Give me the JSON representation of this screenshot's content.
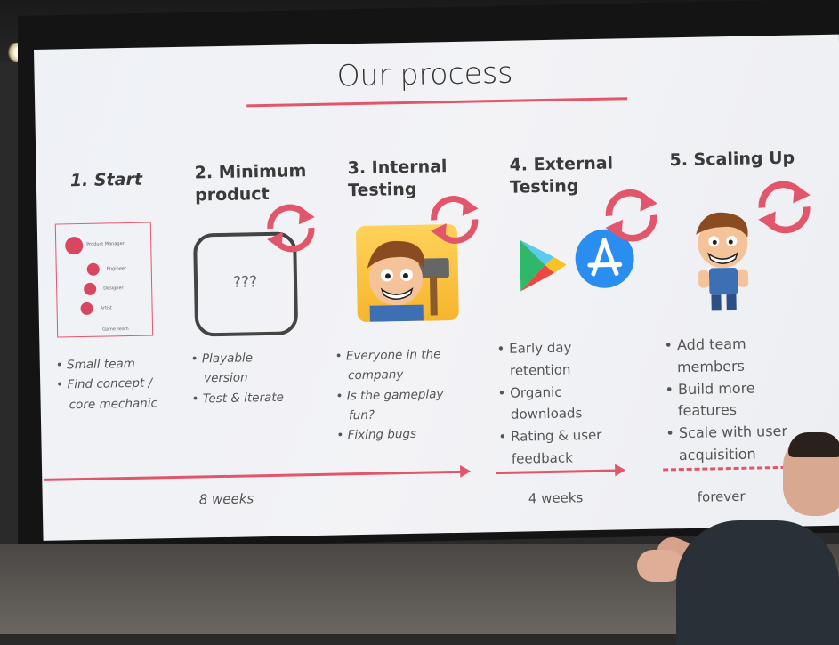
{
  "slide": {
    "title": "Our process",
    "stages": [
      {
        "heading": "1. Start",
        "bullets": [
          "Small team",
          "Find concept / core mechanic"
        ]
      },
      {
        "heading": "2. Minimum product",
        "bullets": [
          "Playable version",
          "Test & iterate"
        ]
      },
      {
        "heading": "3. Internal Testing",
        "bullets": [
          "Everyone in the company",
          "Is the gameplay fun?",
          "Fixing bugs"
        ]
      },
      {
        "heading": "4. External Testing",
        "bullets": [
          "Early day retention",
          "Organic downloads",
          "Rating & user feedback"
        ]
      },
      {
        "heading": "5. Scaling Up",
        "bullets": [
          "Add team members",
          "Build more features",
          "Scale with user acquisition"
        ]
      }
    ],
    "team_diagram": {
      "roles": [
        "Product Manager",
        "Engineer",
        "Designer",
        "Artist"
      ],
      "caption": "Game Team"
    },
    "mvp_placeholder": "???",
    "durations": [
      "8 weeks",
      "4 weeks",
      "forever"
    ]
  },
  "colors": {
    "accent": "#e2566c",
    "slide_bg": "#f0f2f5",
    "text": "#3a3a3a"
  },
  "icons": [
    "cycle-arrows-icon",
    "google-play-icon",
    "app-store-icon",
    "game-character-icon"
  ]
}
